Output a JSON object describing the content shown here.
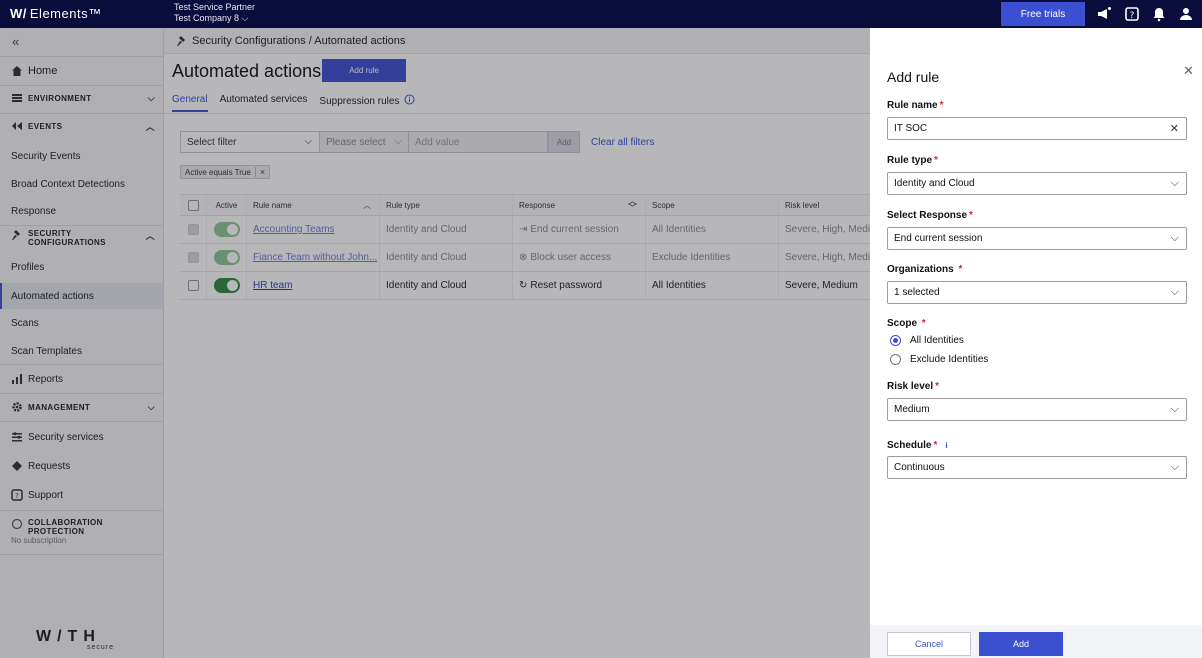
{
  "topbar": {
    "brand": "Elements™",
    "brand_mark": "W/",
    "partner_line1": "Test Service Partner",
    "partner_line2": "Test Company 8",
    "free_trials": "Free trials",
    "icons": [
      "megaphone-icon",
      "help-icon",
      "bell-icon",
      "user-icon"
    ]
  },
  "sidebar": {
    "collapse": "«",
    "items": [
      {
        "label": "Home",
        "type": "item",
        "icon": "home-icon"
      },
      {
        "label": "ENVIRONMENT",
        "type": "section",
        "icon": "list-icon"
      },
      {
        "label": "EVENTS",
        "type": "section",
        "icon": "events-icon"
      },
      {
        "label": "Security Events",
        "type": "sub"
      },
      {
        "label": "Broad Context Detections",
        "type": "sub"
      },
      {
        "label": "Response",
        "type": "sub"
      },
      {
        "label": "SECURITY",
        "label2": "CONFIGURATIONS",
        "type": "section",
        "icon": "gavel-icon"
      },
      {
        "label": "Profiles",
        "type": "sub"
      },
      {
        "label": "Automated actions",
        "type": "sub"
      },
      {
        "label": "Scans",
        "type": "sub"
      },
      {
        "label": "Scan Templates",
        "type": "sub"
      },
      {
        "label": "Reports",
        "type": "item",
        "icon": "chart-icon"
      },
      {
        "label": "MANAGEMENT",
        "type": "section",
        "icon": "gear-icon"
      },
      {
        "label": "Security services",
        "type": "item",
        "icon": "services-icon"
      },
      {
        "label": "Requests",
        "type": "item",
        "icon": "requests-icon"
      },
      {
        "label": "Support",
        "type": "item",
        "icon": "support-icon"
      },
      {
        "label": "COLLABORATION",
        "label2": "PROTECTION",
        "type": "section",
        "icon": "cloud-icon"
      }
    ],
    "no_subscription": "No subscription",
    "logo": "W/TH",
    "logo_sub": "secure"
  },
  "main": {
    "breadcrumb": "Security Configurations / Automated actions",
    "title": "Automated actions",
    "add_rule": "Add rule",
    "tabs": [
      "General",
      "Automated services",
      "Suppression rules"
    ],
    "filter": {
      "select_placeholder": "Select filter",
      "please_select": "Please select",
      "value_placeholder": "Add value",
      "add": "Add",
      "clear": "Clear all filters",
      "chip": "Active equals True"
    },
    "table": {
      "headers": [
        "Active",
        "Rule name",
        "Rule type",
        "Response",
        "Scope",
        "Risk level"
      ],
      "rows": [
        {
          "name": "Accounting Teams",
          "type": "Identity and Cloud",
          "response": "End current session",
          "response_icon": "logout-icon",
          "scope": "All Identities",
          "risk": "Severe, High, Medium",
          "disabled": true
        },
        {
          "name": "Fiance Team without John...",
          "type": "Identity and Cloud",
          "response": "Block user access",
          "response_icon": "block-icon",
          "scope": "Exclude Identities",
          "risk": "Severe, High, Medium",
          "disabled": true
        },
        {
          "name": "HR team",
          "type": "Identity and Cloud",
          "response": "Reset password",
          "response_icon": "reset-icon",
          "scope": "All Identities",
          "risk": "Severe, Medium",
          "disabled": false
        }
      ]
    }
  },
  "panel": {
    "title": "Add rule",
    "rule_name_label": "Rule name",
    "rule_name_value": "IT SOC",
    "rule_type_label": "Rule type",
    "rule_type_value": "Identity and Cloud",
    "response_label": "Select Response",
    "response_value": "End current session",
    "org_label": "Organizations",
    "org_value": "1 selected",
    "scope_label": "Scope",
    "scope_options": [
      "All Identities",
      "Exclude Identities"
    ],
    "risk_label": "Risk level",
    "risk_value": "Medium",
    "schedule_label": "Schedule",
    "schedule_value": "Continuous",
    "cancel": "Cancel",
    "add": "Add"
  },
  "colors": {
    "accent": "#3b4fd1",
    "topbar": "#0a0d3b",
    "required": "#d1263b",
    "toggle_on": "#2e8b3a"
  }
}
